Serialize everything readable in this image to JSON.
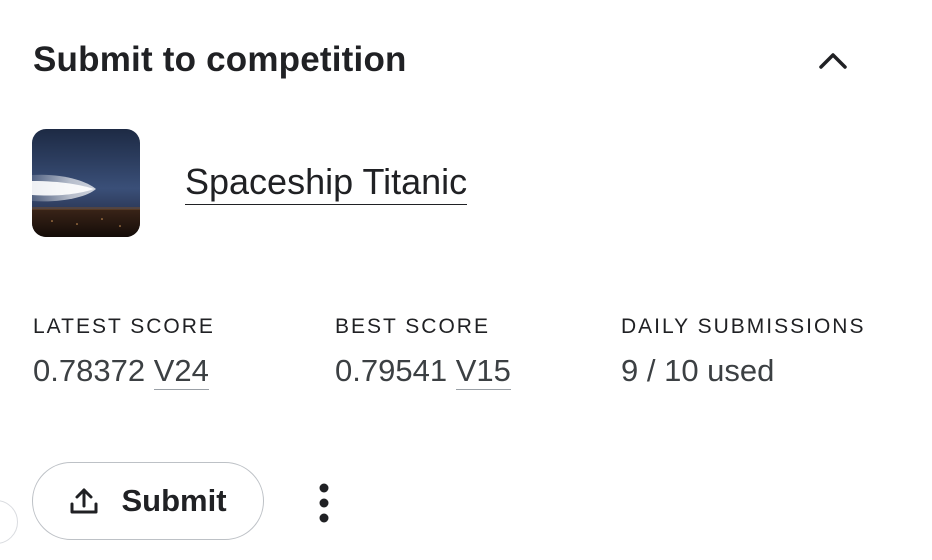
{
  "header": {
    "title": "Submit to competition",
    "collapse_icon": "chevron-up-icon"
  },
  "competition": {
    "name": "Spaceship Titanic",
    "thumbnail_icon": "spaceship-thumbnail"
  },
  "stats": {
    "latest": {
      "label": "LATEST SCORE",
      "score": "0.78372",
      "version": "V24"
    },
    "best": {
      "label": "BEST SCORE",
      "score": "0.79541",
      "version": "V15"
    },
    "daily": {
      "label": "DAILY SUBMISSIONS",
      "value": "9 / 10 used"
    }
  },
  "actions": {
    "submit_label": "Submit",
    "submit_icon": "upload-icon",
    "more_icon": "more-vertical-icon"
  }
}
